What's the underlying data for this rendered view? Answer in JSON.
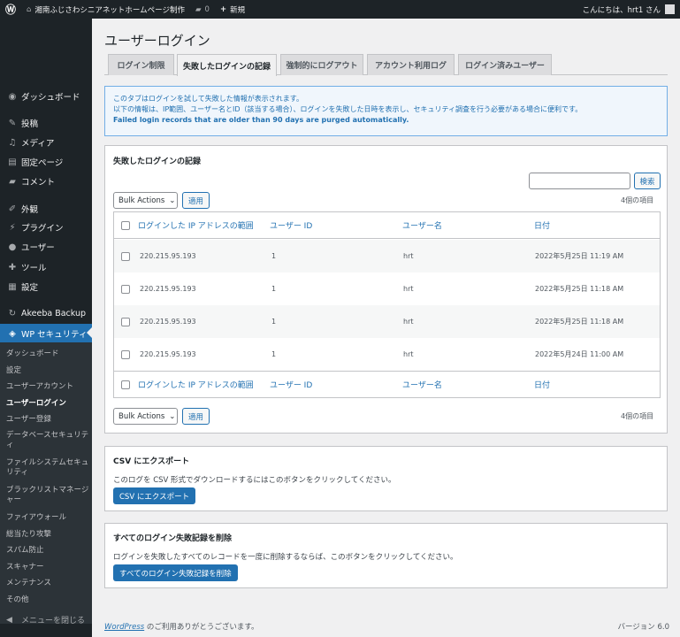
{
  "adminbar": {
    "site_name": "湘南ふじさわシニアネットホームページ制作",
    "comments_count": "0",
    "new_label": "新規",
    "greeting": "こんにちは、hrt1 さん"
  },
  "sidebar": {
    "items": [
      {
        "label": "ダッシュボード",
        "icon": "dashboard-icon",
        "glyph": "◉"
      },
      {
        "label": "投稿",
        "icon": "pin-icon",
        "glyph": "✎"
      },
      {
        "label": "メディア",
        "icon": "media-icon",
        "glyph": "♫"
      },
      {
        "label": "固定ページ",
        "icon": "page-icon",
        "glyph": "▤"
      },
      {
        "label": "コメント",
        "icon": "comment-icon",
        "glyph": "▰"
      },
      {
        "label": "外観",
        "icon": "appearance-icon",
        "glyph": "✐"
      },
      {
        "label": "プラグイン",
        "icon": "plugin-icon",
        "glyph": "⚡"
      },
      {
        "label": "ユーザー",
        "icon": "user-icon",
        "glyph": "●"
      },
      {
        "label": "ツール",
        "icon": "tool-icon",
        "glyph": "✚"
      },
      {
        "label": "設定",
        "icon": "settings-icon",
        "glyph": "▦"
      },
      {
        "label": "Akeeba Backup",
        "icon": "akeeba-icon",
        "glyph": "↻"
      },
      {
        "label": "WP セキュリティ",
        "icon": "shield-icon",
        "glyph": "◈"
      }
    ],
    "submenu": [
      "ダッシュボード",
      "設定",
      "ユーザーアカウント",
      "ユーザーログイン",
      "ユーザー登録",
      "データベースセキュリティ",
      "ファイルシステムセキュリティ",
      "ブラックリストマネージャー",
      "ファイアウォール",
      "総当たり攻撃",
      "スパム防止",
      "スキャナー",
      "メンテナンス",
      "その他"
    ],
    "collapse_label": "メニューを閉じる"
  },
  "page": {
    "title": "ユーザーログイン",
    "tabs": [
      "ログイン制限",
      "失敗したログインの記録",
      "強制的にログアウト",
      "アカウント利用ログ",
      "ログイン済みユーザー"
    ]
  },
  "notice": {
    "line1": "このタブはログインを試して失敗した情報が表示されます。",
    "line2": "以下の情報は、IP範囲、ユーザー名とID（該当する場合）、ログインを失敗した日時を表示し、セキュリティ調査を行う必要がある場合に便利です。",
    "line3": "Failed login records that are older than 90 days are purged automatically."
  },
  "records": {
    "title": "失敗したログインの記録",
    "search_button": "検索",
    "bulk_actions": "Bulk Actions",
    "apply": "適用",
    "items_count": "4個の項目",
    "columns": [
      "ログインした IP アドレスの範囲",
      "ユーザー ID",
      "ユーザー名",
      "日付"
    ],
    "rows": [
      {
        "ip": "220.215.95.193",
        "user_id": "1",
        "username": "hrt",
        "date": "2022年5月25日 11:19 AM"
      },
      {
        "ip": "220.215.95.193",
        "user_id": "1",
        "username": "hrt",
        "date": "2022年5月25日 11:18 AM"
      },
      {
        "ip": "220.215.95.193",
        "user_id": "1",
        "username": "hrt",
        "date": "2022年5月25日 11:18 AM"
      },
      {
        "ip": "220.215.95.193",
        "user_id": "1",
        "username": "hrt",
        "date": "2022年5月24日 11:00 AM"
      }
    ]
  },
  "csv": {
    "title": "CSV にエクスポート",
    "desc": "このログを CSV 形式でダウンロードするにはこのボタンをクリックしてください。",
    "button": "CSV にエクスポート"
  },
  "delete": {
    "title": "すべてのログイン失敗記録を削除",
    "desc": "ログインを失敗したすべてのレコードを一度に削除するならば、このボタンをクリックしてください。",
    "button": "すべてのログイン失敗記録を削除"
  },
  "footer": {
    "link": "WordPress",
    "thanks": " のご利用ありがとうございます。",
    "version": "バージョン 6.0"
  }
}
